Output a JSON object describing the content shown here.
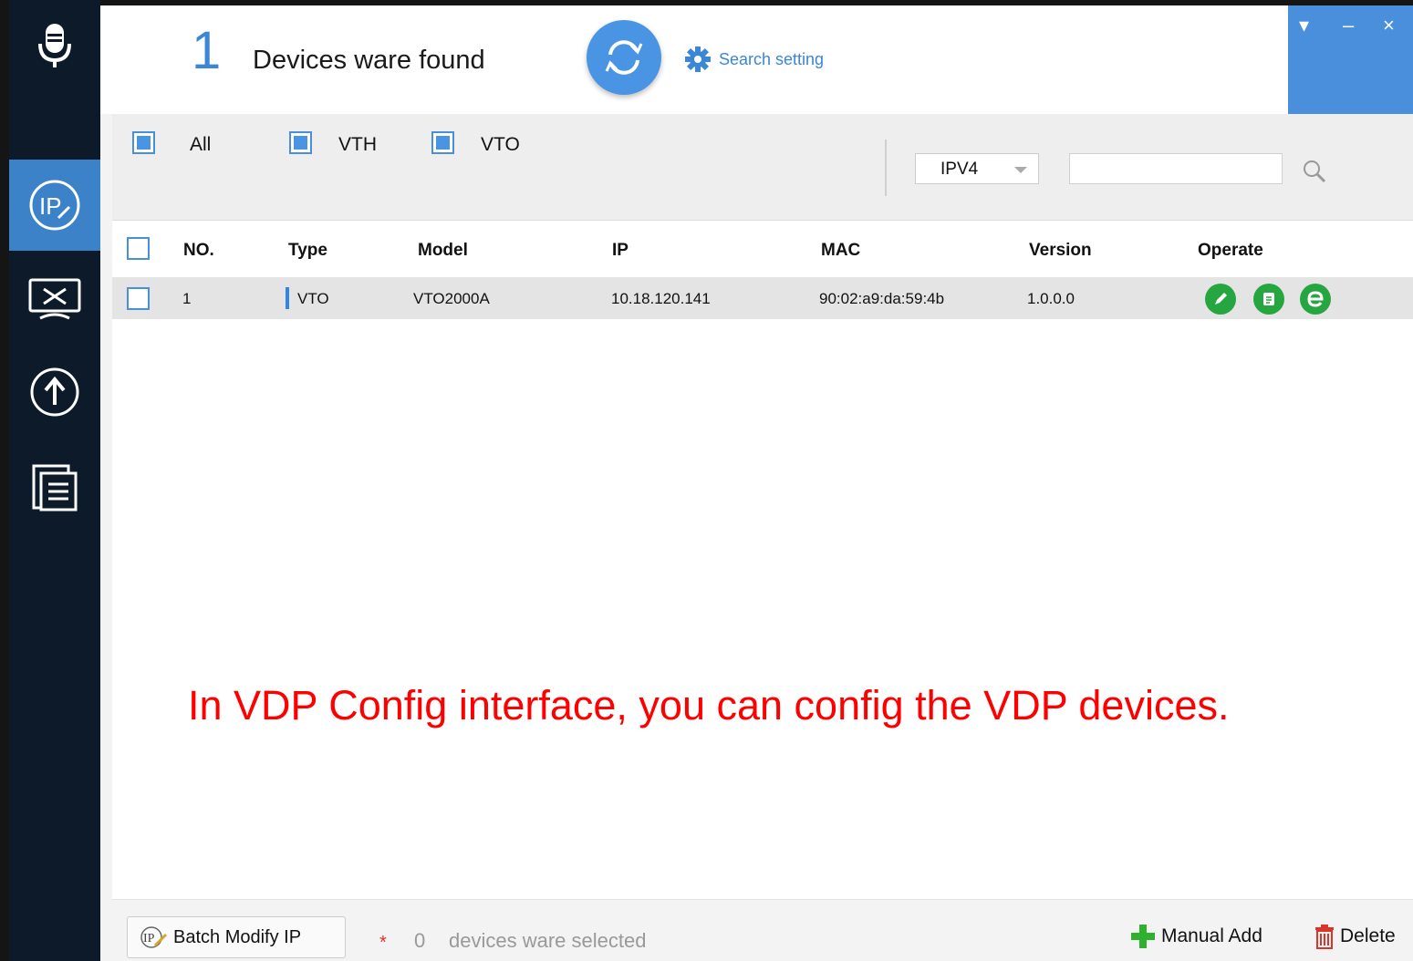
{
  "header": {
    "device_count": "1",
    "found_label": "Devices ware found",
    "search_setting_label": "Search setting"
  },
  "window_controls": {
    "menu": "▾",
    "minimize": "–",
    "close": "×"
  },
  "filters": {
    "all_label": "All",
    "vth_label": "VTH",
    "vto_label": "VTO",
    "ip_version": "IPV4",
    "search_value": ""
  },
  "table": {
    "headers": {
      "no": "NO.",
      "type": "Type",
      "model": "Model",
      "ip": "IP",
      "mac": "MAC",
      "version": "Version",
      "operate": "Operate"
    },
    "rows": [
      {
        "no": "1",
        "type": "VTO",
        "model": "VTO2000A",
        "ip": "10.18.120.141",
        "mac": "90:02:a9:da:59:4b",
        "version": "1.0.0.0"
      }
    ]
  },
  "annotation": "In VDP Config interface, you can config the VDP devices.",
  "footer": {
    "batch_modify_label": "Batch Modify IP",
    "batch_icon_text": "IP",
    "selected_star": "*",
    "selected_count": "0",
    "selected_text": "devices ware selected",
    "manual_add_label": "Manual Add",
    "delete_label": "Delete"
  },
  "colors": {
    "accent": "#4a95e3",
    "sidebar": "#0d1a29",
    "operate_green": "#26a641",
    "annotation_red": "#ff0000"
  },
  "icons": {
    "sidebar": [
      "microphone-icon",
      "ip-config-icon",
      "tools-icon",
      "upgrade-icon",
      "documents-icon"
    ],
    "operate": [
      "edit-icon",
      "details-icon",
      "web-icon"
    ]
  }
}
